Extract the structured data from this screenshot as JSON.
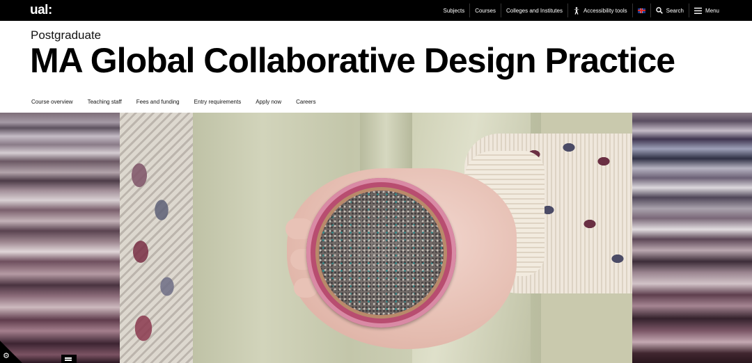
{
  "topbar": {
    "logo": "ual:",
    "nav": [
      {
        "label": "Subjects"
      },
      {
        "label": "Courses"
      },
      {
        "label": "Colleges and Institutes"
      },
      {
        "label": "Accessibility tools",
        "icon": "accessibility-icon"
      },
      {
        "label": "",
        "icon": "uk-flag-icon"
      },
      {
        "label": "Search",
        "icon": "search-icon"
      },
      {
        "label": "Menu",
        "icon": "hamburger-icon"
      }
    ]
  },
  "header": {
    "level": "Postgraduate",
    "title": "MA Global Collaborative Design Practice"
  },
  "subnav": [
    "Course overview",
    "Teaching staff",
    "Fees and funding",
    "Entry requirements",
    "Apply now",
    "Careers"
  ],
  "controls": {
    "cookie_icon": "gear-icon",
    "list_icon": "list-icon"
  },
  "colors": {
    "topbar_bg": "#000000",
    "title_text": "#000000",
    "disk_rim": "#b84d70"
  }
}
